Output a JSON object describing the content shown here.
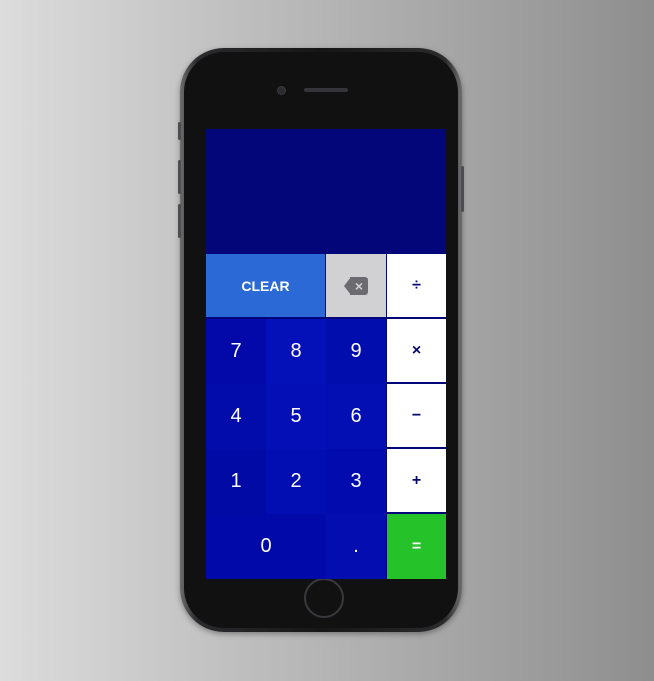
{
  "display": {
    "value": ""
  },
  "keys": {
    "clear": "CLEAR",
    "backspace": "⌫",
    "divide": "÷",
    "multiply": "×",
    "subtract": "−",
    "add": "+",
    "equals": "=",
    "seven": "7",
    "eight": "8",
    "nine": "9",
    "four": "4",
    "five": "5",
    "six": "6",
    "one": "1",
    "two": "2",
    "three": "3",
    "zero": "0",
    "decimal": "."
  },
  "colors": {
    "screen": "#020679",
    "clear_key": "#2b6ad6",
    "backspace_key": "#d1d1d4",
    "operator_key": "#ffffff",
    "equals_key": "#26c22a"
  },
  "icons": {
    "backspace": "backspace-icon"
  }
}
